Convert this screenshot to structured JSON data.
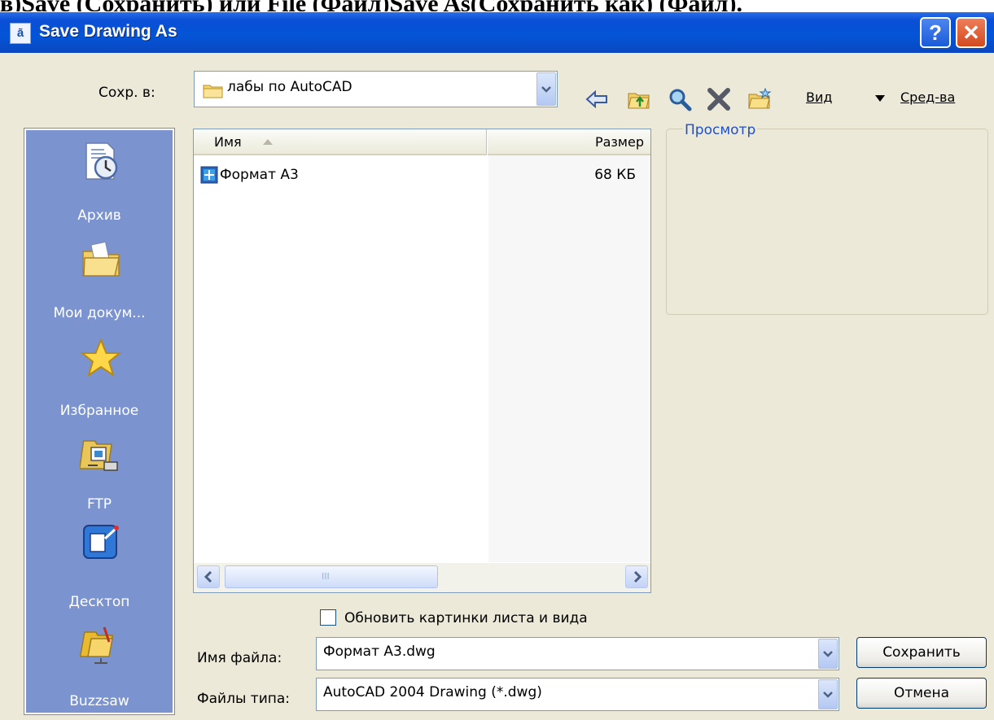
{
  "page_caption": "в)Save (Сохранить) или File (Файл)Save As(Сохранить как) (Файл).",
  "window": {
    "title": "Save Drawing As",
    "title_icon_glyph": "ā",
    "help_label": "?",
    "close_label": "✕"
  },
  "save_in": {
    "label": "Сохр. в:",
    "value": "лабы по AutoCAD"
  },
  "toolbar": {
    "icons": [
      "back-arrow-icon",
      "up-folder-icon",
      "search-web-icon",
      "delete-icon",
      "new-folder-icon"
    ],
    "views_label": "Вид",
    "tools_label": "Сред-ва"
  },
  "places": [
    {
      "label": "Архив",
      "icon": "history-clock-icon"
    },
    {
      "label": "Мои докум...",
      "icon": "my-documents-icon"
    },
    {
      "label": "Избранное",
      "icon": "favorites-star-icon"
    },
    {
      "label": "FTP",
      "icon": "ftp-icon"
    },
    {
      "label": "Десктоп",
      "icon": "desktop-icon"
    },
    {
      "label": "Buzzsaw",
      "icon": "buzzsaw-icon"
    }
  ],
  "file_list": {
    "columns": [
      "Имя",
      "Размер"
    ],
    "rows": [
      {
        "name": "Формат А3",
        "size": "68 КБ"
      }
    ],
    "scroll_grip": "III"
  },
  "preview": {
    "label": "Просмотр"
  },
  "update_thumbnail": {
    "label": "Обновить картинки листа и вида",
    "checked": false
  },
  "file_name": {
    "label": "Имя файла:",
    "value": "Формат А3.dwg"
  },
  "file_type": {
    "label": "Файлы типа:",
    "value": "AutoCAD 2004 Drawing (*.dwg)"
  },
  "buttons": {
    "save_label": "Сохранить",
    "cancel_label": "Отмена"
  },
  "colors": {
    "titlebar": "#0454d6",
    "dialog_bg": "#ece9d8",
    "places_bar": "#7b93cf",
    "group_label": "#1f4fc8"
  }
}
